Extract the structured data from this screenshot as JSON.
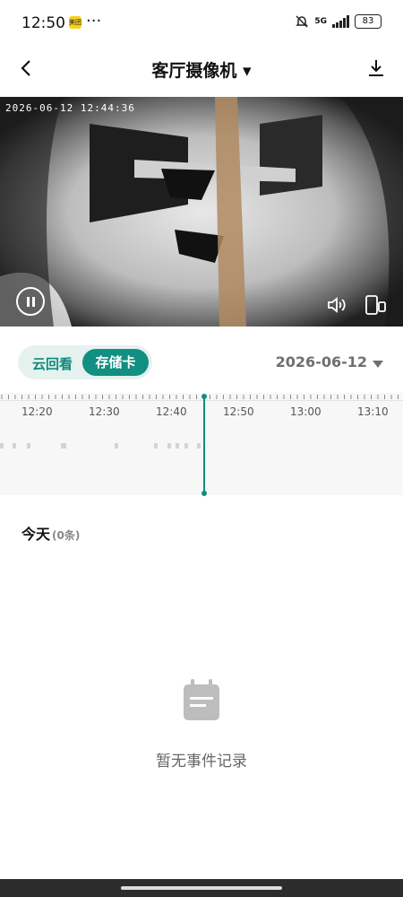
{
  "status_bar": {
    "time": "12:50",
    "app_badge": "美团",
    "more": "···",
    "network": "5G",
    "battery": "83"
  },
  "header": {
    "title": "客厅摄像机 ▾"
  },
  "video": {
    "timestamp": "2026-06-12  12:44:36"
  },
  "playback_tabs": {
    "cloud": "云回看",
    "sdcard": "存储卡",
    "active": "存储卡"
  },
  "date_selector": {
    "value": "2026-06-12"
  },
  "timeline": {
    "labels": [
      "12:20",
      "12:30",
      "12:40",
      "12:50",
      "13:00",
      "13:10"
    ],
    "current_time": "12:44:36"
  },
  "events": {
    "title": "今天",
    "count": "(0条)",
    "empty_message": "暂无事件记录"
  },
  "colors": {
    "accent": "#128f80",
    "tab_bg": "#e6f2f0",
    "timeline_bg": "#f7f7f7"
  }
}
